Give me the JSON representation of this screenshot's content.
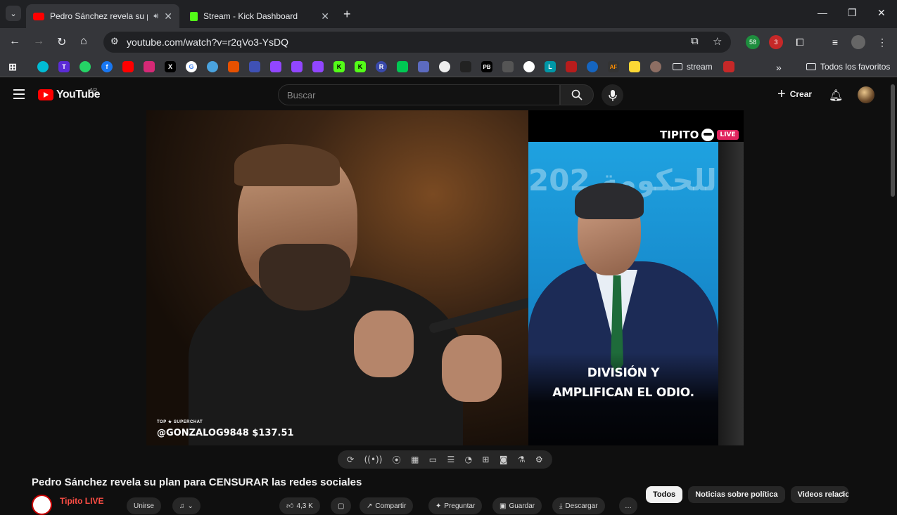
{
  "browser": {
    "tabs": [
      {
        "title": "Pedro Sánchez revela su plan para CENSURAR las redes sociales",
        "favicon": "youtube-icon",
        "active": true,
        "audio": true
      },
      {
        "title": "Stream - Kick Dashboard",
        "favicon": "kick-icon",
        "active": false
      }
    ],
    "url": "youtube.com/watch?v=r2qVo3-YsDQ",
    "extension_badges": {
      "ext1": "58",
      "ext2": "3"
    },
    "bookmarks_folder": "stream",
    "all_bookmarks": "Todos los favoritos"
  },
  "youtube": {
    "logo_text": "YouTube",
    "region": "AR",
    "search_placeholder": "Buscar",
    "create_label": "Crear"
  },
  "video": {
    "superchat_label": "TOP ★ SUPERCHAT",
    "superchat_text": "@GONZALOG9848 $137.51",
    "brand": "TIPITO",
    "brand_live": "LIVE",
    "caption_line1": "DIVISIÓN Y",
    "caption_line2": "AMPLIFICAN EL ODIO.",
    "stage_text": "للحكومة 202"
  },
  "page": {
    "title": "Pedro Sánchez revela su plan para CENSURAR las redes sociales",
    "channel_name": "Tipito LIVE",
    "join_label": "Unirse",
    "likes": "4,3 K",
    "share_label": "Compartir",
    "ask_label": "Preguntar",
    "save_label": "Guardar",
    "download_label": "Descargar",
    "chips": [
      "Todos",
      "Noticias sobre política",
      "Videos relacio"
    ]
  },
  "colors": {
    "accent": "#ff0000",
    "kick": "#53fc18",
    "bg": "#0f0f0f"
  }
}
